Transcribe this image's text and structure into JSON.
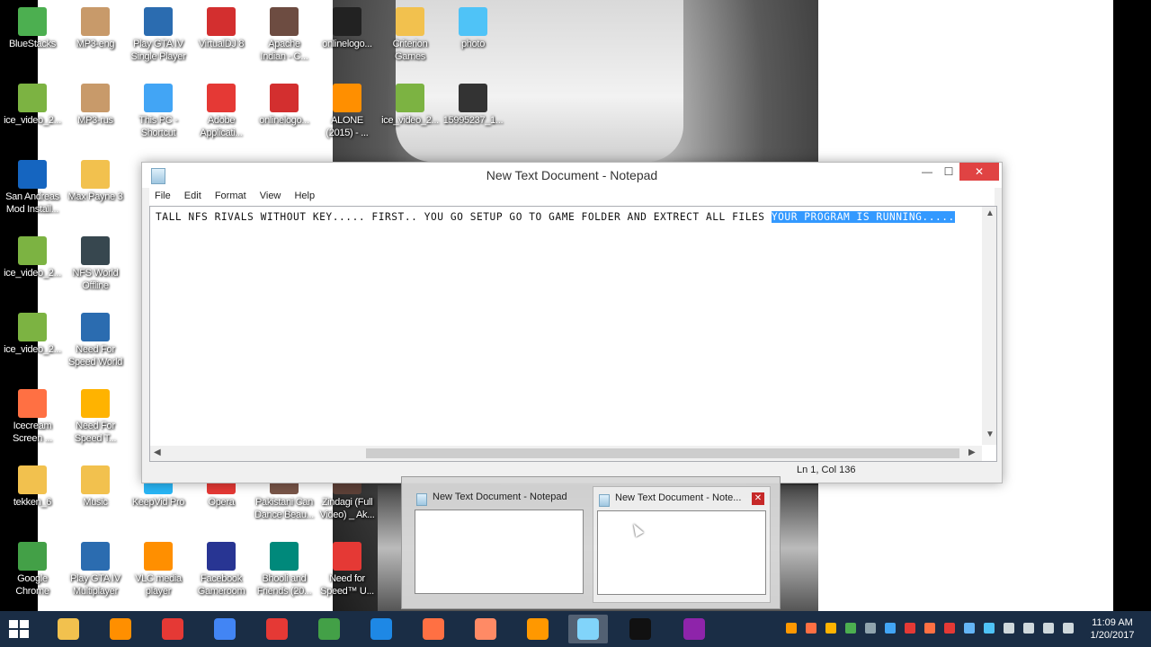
{
  "desktop": {
    "icons": [
      {
        "label": "BlueStacks",
        "icon": "bluestacks-icon",
        "color": "#4caf50"
      },
      {
        "label": "MP3-eng",
        "icon": "mp3-file-icon",
        "color": "#c89a6a"
      },
      {
        "label": "Play GTA IV\nSingle Player",
        "icon": "shortcut-icon",
        "color": "#2b6cb0"
      },
      {
        "label": "VirtualDJ 8",
        "icon": "virtualdj-icon",
        "color": "#d32f2f"
      },
      {
        "label": "Apache\nIndian - C...",
        "icon": "video-file-icon",
        "color": "#6d4c41"
      },
      {
        "label": "onlinelogo...",
        "icon": "image-file-icon",
        "color": "#222222"
      },
      {
        "label": "Criterion\nGames",
        "icon": "folder-icon",
        "color": "#f2c14e"
      },
      {
        "label": "photo",
        "icon": "photo-icon",
        "color": "#4fc3f7"
      },
      {
        "label": "ice_video_2...",
        "icon": "ice-video-icon",
        "color": "#7cb342"
      },
      {
        "label": "MP3-rus",
        "icon": "mp3-file-icon",
        "color": "#c89a6a"
      },
      {
        "label": "This PC -\nShortcut",
        "icon": "this-pc-icon",
        "color": "#42a5f5"
      },
      {
        "label": "Adobe\nApplicati...",
        "icon": "adobe-icon",
        "color": "#e53935"
      },
      {
        "label": "onlinelogo...",
        "icon": "image-file-icon",
        "color": "#d32f2f"
      },
      {
        "label": "ALONE\n(2015) - ...",
        "icon": "vlc-icon",
        "color": "#ff8f00"
      },
      {
        "label": "ice_video_2...",
        "icon": "ice-video-icon",
        "color": "#7cb342"
      },
      {
        "label": "15995237_1...",
        "icon": "image-file-icon",
        "color": "#333333"
      },
      {
        "label": "San Andreas\nMod Install...",
        "icon": "san-andreas-icon",
        "color": "#1565c0"
      },
      {
        "label": "Max Payne 3",
        "icon": "folder-icon",
        "color": "#f2c14e"
      },
      {
        "label": "ice_video_2...",
        "icon": "ice-video-icon",
        "color": "#7cb342"
      },
      {
        "label": "NFS World\nOffline",
        "icon": "nfs-world-icon",
        "color": "#37474f"
      },
      {
        "label": "ice_video_2...",
        "icon": "ice-video-icon",
        "color": "#7cb342"
      },
      {
        "label": "Need For\nSpeed World",
        "icon": "shortcut-icon",
        "color": "#2b6cb0"
      },
      {
        "label": "Icecream\nScreen ...",
        "icon": "icecream-icon",
        "color": "#ff7043"
      },
      {
        "label": "Need For\nSpeed T...",
        "icon": "nfs-icon",
        "color": "#ffb300"
      },
      {
        "label": "tekken_6",
        "icon": "folder-icon",
        "color": "#f2c14e"
      },
      {
        "label": "Music",
        "icon": "music-folder-icon",
        "color": "#f2c14e"
      },
      {
        "label": "KeepVid Pro",
        "icon": "keepvid-icon",
        "color": "#29b6f6"
      },
      {
        "label": "Opera",
        "icon": "opera-icon",
        "color": "#e53935"
      },
      {
        "label": "Pakistani Can\nDance Beau...",
        "icon": "video-file-icon",
        "color": "#795548"
      },
      {
        "label": "Zindagi (Full\nVideo) _ Ak...",
        "icon": "video-file-icon",
        "color": "#5d4037"
      },
      {
        "label": "Google\nChrome",
        "icon": "chrome-icon",
        "color": "#43a047"
      },
      {
        "label": "Play GTA IV\nMultiplayer",
        "icon": "shortcut-icon",
        "color": "#2b6cb0"
      },
      {
        "label": "VLC media\nplayer",
        "icon": "vlc-icon",
        "color": "#ff8f00"
      },
      {
        "label": "Facebook\nGameroom",
        "icon": "facebook-gameroom-icon",
        "color": "#283593"
      },
      {
        "label": "Bhooli and\nFriends (20...",
        "icon": "image-file-icon",
        "color": "#00897b"
      },
      {
        "label": "Need for\nSpeed™ U...",
        "icon": "nfs-icon",
        "color": "#e53935"
      }
    ]
  },
  "notepad": {
    "title": "New Text Document - Notepad",
    "minimize": "—",
    "maximize": "☐",
    "close": "✕",
    "menu": [
      "File",
      "Edit",
      "Format",
      "View",
      "Help"
    ],
    "text_before": "TALL NFS RIVALS WITHOUT KEY..... FIRST.. YOU GO SETUP GO TO GAME FOLDER AND EXTRECT ALL FILES ",
    "text_selected": "YOUR PROGRAM IS RUNNING.....",
    "status": "Ln 1, Col 136"
  },
  "thumbnails": [
    {
      "title": "New Text Document - Notepad"
    },
    {
      "title": "New Text Document - Note...",
      "close": "✕"
    }
  ],
  "taskbar": {
    "items": [
      {
        "icon": "file-explorer-icon",
        "color": "#f2c14e"
      },
      {
        "icon": "vlc-icon",
        "color": "#ff8f00"
      },
      {
        "icon": "video-recorder-icon",
        "color": "#e53935"
      },
      {
        "icon": "chromium-icon",
        "color": "#4285f4"
      },
      {
        "icon": "opera-icon",
        "color": "#e53935"
      },
      {
        "icon": "chrome-icon",
        "color": "#43a047"
      },
      {
        "icon": "photoshop-icon",
        "color": "#1e88e5"
      },
      {
        "icon": "icecream-icon",
        "color": "#ff7043"
      },
      {
        "icon": "icecream-screenshot-icon",
        "color": "#ff8a65"
      },
      {
        "icon": "media-player-icon",
        "color": "#ff9800"
      },
      {
        "icon": "notepad-icon",
        "color": "#81d4fa"
      },
      {
        "icon": "red-app-icon",
        "color": "#111111"
      },
      {
        "icon": "winrar-icon",
        "color": "#8e24aa"
      }
    ],
    "time": "11:09 AM",
    "date": "1/20/2017",
    "tray_colors": [
      "#ff9800",
      "#ff7043",
      "#ffb300",
      "#4caf50",
      "#90a4ae",
      "#42a5f5",
      "#e53935",
      "#ff7043",
      "#e53935",
      "#64b5f6",
      "#4fc3f7",
      "#cfd8dc",
      "#cfd8dc",
      "#cfd8dc",
      "#cfd8dc"
    ]
  }
}
